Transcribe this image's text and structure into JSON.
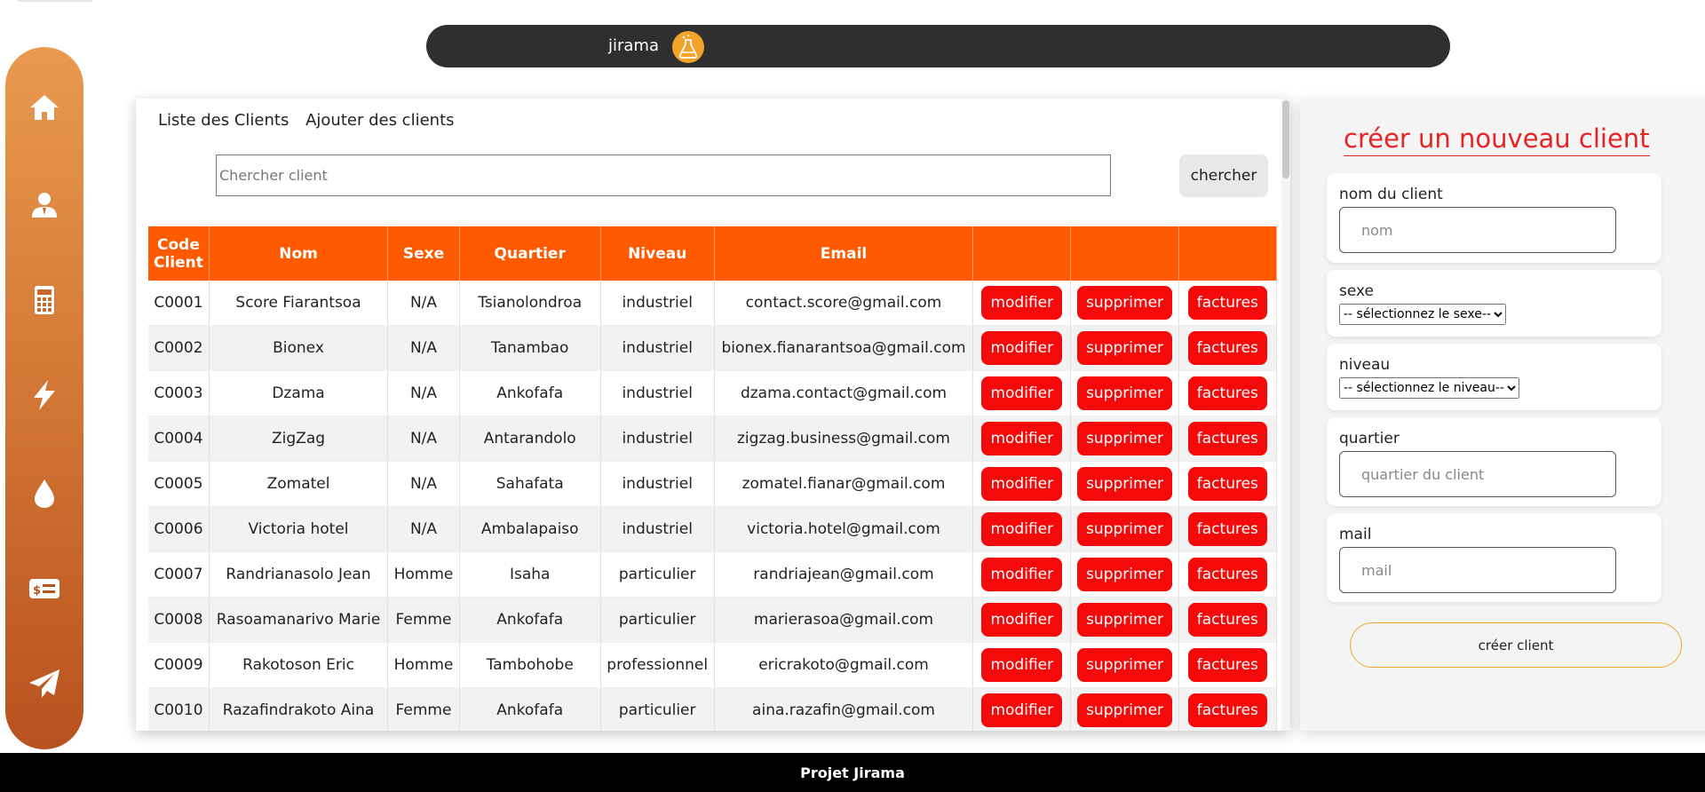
{
  "header": {
    "title": "jirama",
    "logo_icon": "flask-icon"
  },
  "sidebar": {
    "items": [
      {
        "name": "home",
        "icon": "home-icon"
      },
      {
        "name": "clients",
        "icon": "user-icon"
      },
      {
        "name": "calculator",
        "icon": "calculator-icon"
      },
      {
        "name": "electricity",
        "icon": "bolt-icon"
      },
      {
        "name": "water",
        "icon": "drop-icon"
      },
      {
        "name": "billing",
        "icon": "money-card-icon"
      },
      {
        "name": "send",
        "icon": "paper-plane-icon"
      }
    ]
  },
  "main": {
    "tabs": [
      {
        "label": "Liste des Clients"
      },
      {
        "label": "Ajouter des clients"
      }
    ],
    "search": {
      "placeholder": "Chercher client",
      "button_label": "chercher"
    },
    "table": {
      "columns": [
        "Code Client",
        "Nom",
        "Sexe",
        "Quartier",
        "Niveau",
        "Email",
        "",
        "",
        ""
      ],
      "actions": {
        "edit": "modifier",
        "delete": "supprimer",
        "invoices": "factures"
      },
      "rows": [
        [
          "C0001",
          "Score Fiarantsoa",
          "N/A",
          "Tsianolondroa",
          "industriel",
          "contact.score@gmail.com"
        ],
        [
          "C0002",
          "Bionex",
          "N/A",
          "Tanambao",
          "industriel",
          "bionex.fianarantsoa@gmail.com"
        ],
        [
          "C0003",
          "Dzama",
          "N/A",
          "Ankofafa",
          "industriel",
          "dzama.contact@gmail.com"
        ],
        [
          "C0004",
          "ZigZag",
          "N/A",
          "Antarandolo",
          "industriel",
          "zigzag.business@gmail.com"
        ],
        [
          "C0005",
          "Zomatel",
          "N/A",
          "Sahafata",
          "industriel",
          "zomatel.fianar@gmail.com"
        ],
        [
          "C0006",
          "Victoria hotel",
          "N/A",
          "Ambalapaiso",
          "industriel",
          "victoria.hotel@gmail.com"
        ],
        [
          "C0007",
          "Randrianasolo Jean",
          "Homme",
          "Isaha",
          "particulier",
          "randriajean@gmail.com"
        ],
        [
          "C0008",
          "Rasoamanarivo Marie",
          "Femme",
          "Ankofafa",
          "particulier",
          "marierasoa@gmail.com"
        ],
        [
          "C0009",
          "Rakotoson Eric",
          "Homme",
          "Tambohobe",
          "professionnel",
          "ericrakoto@gmail.com"
        ],
        [
          "C0010",
          "Razafindrakoto Aina",
          "Femme",
          "Ankofafa",
          "particulier",
          "aina.razafin@gmail.com"
        ]
      ]
    }
  },
  "form": {
    "title": "créer un nouveau client",
    "fields": {
      "nom": {
        "label": "nom du client",
        "placeholder": "nom"
      },
      "sexe": {
        "label": "sexe",
        "selected": "-- sélectionnez le sexe--"
      },
      "niveau": {
        "label": "niveau",
        "selected": "-- sélectionnez le niveau--"
      },
      "quartier": {
        "label": "quartier",
        "placeholder": "quartier du client"
      },
      "mail": {
        "label": "mail",
        "placeholder": "mail"
      }
    },
    "submit_label": "créer client"
  },
  "footer": {
    "text": "Projet Jirama"
  },
  "colors": {
    "accent": "#ff5a00",
    "danger": "#f40a0a",
    "header_bg": "#2f2f2f",
    "sidebar_top": "#e89a4f",
    "sidebar_bottom": "#b8521f",
    "footer_bg": "#000000"
  }
}
